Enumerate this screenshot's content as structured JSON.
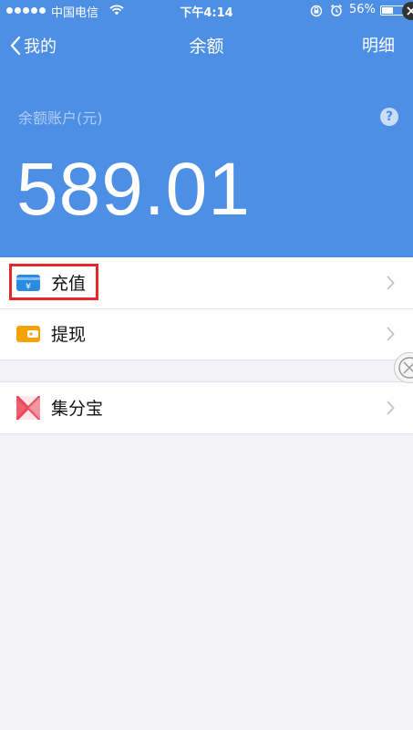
{
  "status_bar": {
    "carrier": "中国电信",
    "time": "下午4:14",
    "battery": "56%"
  },
  "nav": {
    "back_label": "我的",
    "title": "余额",
    "detail_label": "明细"
  },
  "balance": {
    "label": "余额账户(元)",
    "help_glyph": "?",
    "amount": "589.01"
  },
  "menu_groups": [
    {
      "items": [
        {
          "label": "充值",
          "icon": "recharge-card-icon",
          "highlighted": true
        },
        {
          "label": "提现",
          "icon": "wallet-icon",
          "highlighted": false
        }
      ]
    },
    {
      "items": [
        {
          "label": "集分宝",
          "icon": "jifenbao-icon",
          "highlighted": false
        }
      ]
    }
  ],
  "colors": {
    "header_blue": "#4e8fe6",
    "highlight_red": "#e8262c",
    "recharge_icon_blue": "#2a8be0",
    "wallet_icon_orange": "#f5a300",
    "jifenbao_icon_red": "#e9475a"
  },
  "battery_level": 0.56
}
